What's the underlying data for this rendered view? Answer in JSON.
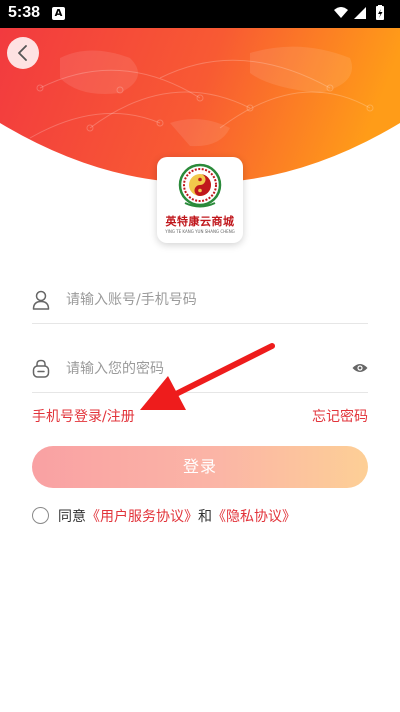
{
  "status_bar": {
    "time": "5:38",
    "notification_badge": "A"
  },
  "logo": {
    "name": "英特康云商城",
    "subtitle": "YING TE KANG YUN SHANG CHENG"
  },
  "account_field": {
    "placeholder": "请输入账号/手机号码",
    "icon": "user-icon"
  },
  "password_field": {
    "placeholder": "请输入您的密码",
    "icon": "lock-icon"
  },
  "links": {
    "phone_login": "手机号登录/注册",
    "forgot_password": "忘记密码"
  },
  "login_button": {
    "label": "登录"
  },
  "agreement": {
    "prefix": "同意",
    "user_agreement": "《用户服务协议》",
    "and": "和",
    "privacy_agreement": "《隐私协议》"
  },
  "colors": {
    "accent": "#e2343b",
    "header_start": "#f23a3f",
    "header_end": "#ff9a1a"
  }
}
